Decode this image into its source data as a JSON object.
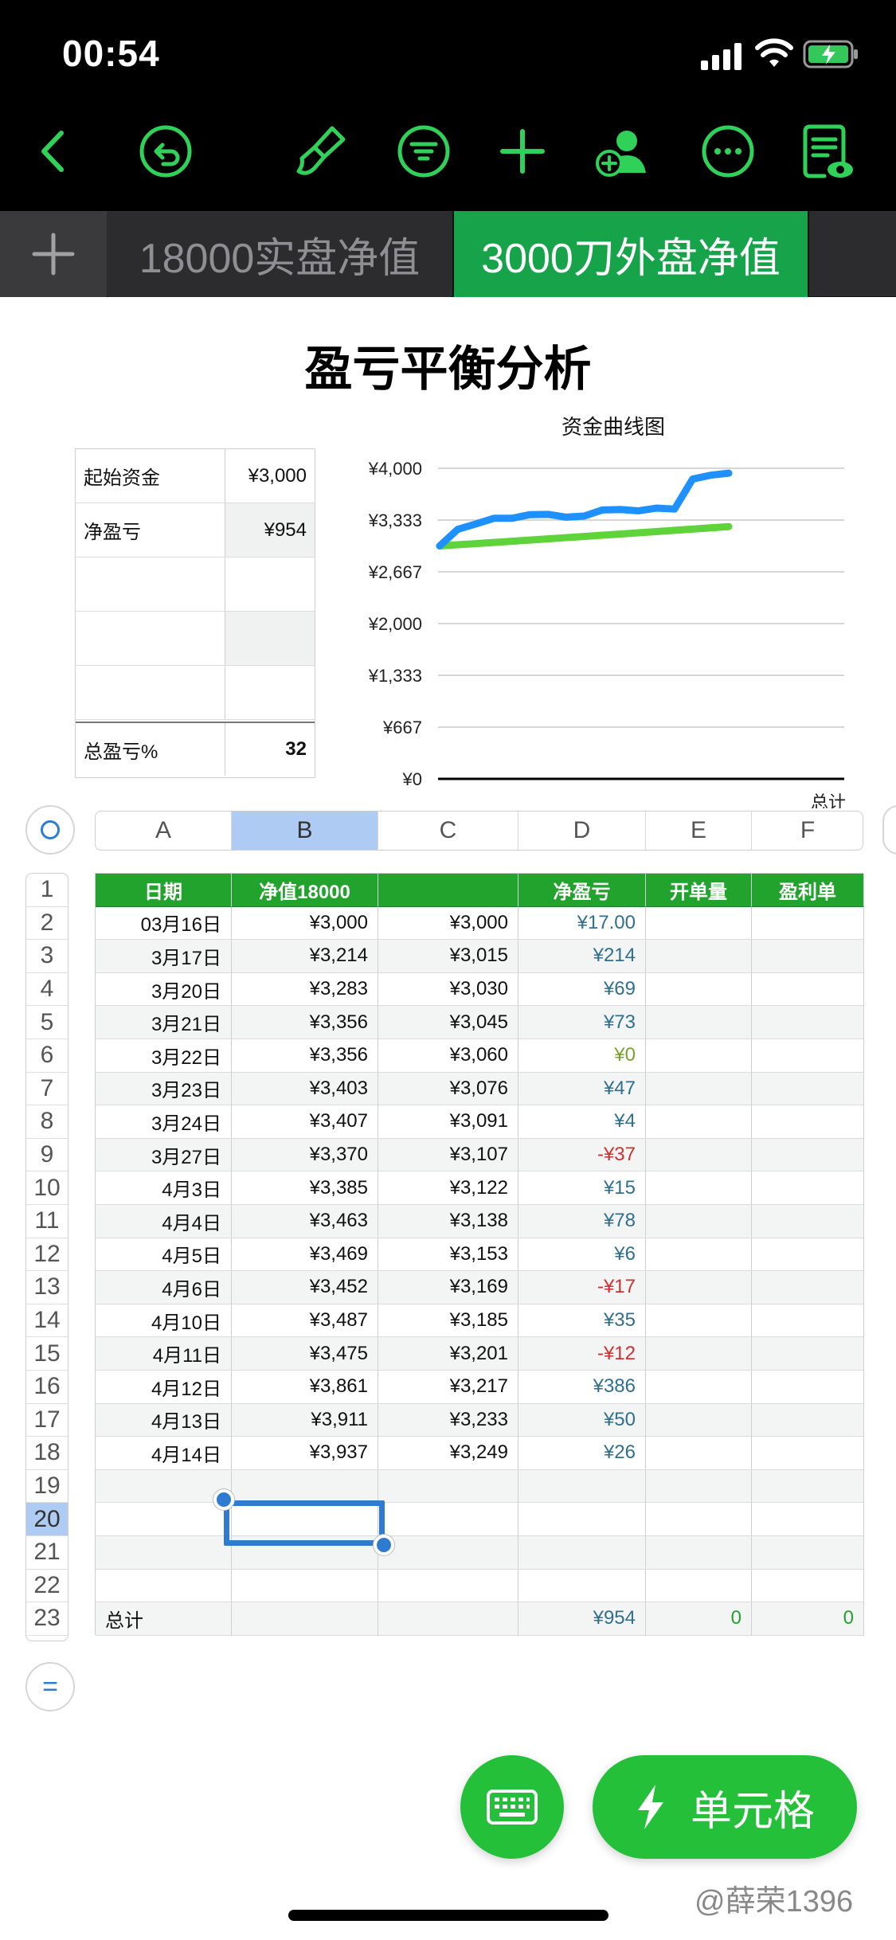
{
  "status_bar": {
    "time": "00:54"
  },
  "toolbar": {
    "icons": [
      "back-icon",
      "undo-icon",
      "brush-icon",
      "filter-icon",
      "add-icon",
      "collaborate-icon",
      "more-icon",
      "reading-view-icon"
    ],
    "accent_color": "#30d158"
  },
  "sheet_tabs": {
    "add_label": "+",
    "tabs": [
      {
        "label": "18000实盘净值",
        "active": false
      },
      {
        "label": "3000刀外盘净值",
        "active": true
      }
    ]
  },
  "page_title": "盈亏平衡分析",
  "summary_table": {
    "rows": [
      {
        "label": "起始资金",
        "value": "¥3,000"
      },
      {
        "label": "净盈亏",
        "value": "¥954"
      },
      {
        "label": "",
        "value": ""
      },
      {
        "label": "",
        "value": ""
      },
      {
        "label": "",
        "value": ""
      },
      {
        "label": "总盈亏%",
        "value": "32"
      }
    ]
  },
  "chart_data": {
    "type": "line",
    "title": "资金曲线图",
    "xlabel": "总计",
    "ylabel": "",
    "ylim": [
      0,
      4000
    ],
    "y_ticks": [
      "¥0",
      "¥667",
      "¥1,333",
      "¥2,000",
      "¥2,667",
      "¥3,333",
      "¥4,000"
    ],
    "grid": true,
    "x": [
      "03月16日",
      "3月17日",
      "3月20日",
      "3月21日",
      "3月22日",
      "3月23日",
      "3月24日",
      "3月27日",
      "4月3日",
      "4月4日",
      "4月5日",
      "4月6日",
      "4月10日",
      "4月11日",
      "4月12日",
      "4月13日",
      "4月14日"
    ],
    "series": [
      {
        "color": "#1e90ff",
        "values": [
          3000,
          3214,
          3283,
          3356,
          3356,
          3403,
          3407,
          3370,
          3385,
          3463,
          3469,
          3452,
          3487,
          3475,
          3861,
          3911,
          3937
        ]
      },
      {
        "color": "#5fd33a",
        "values": [
          3000,
          3015,
          3030,
          3045,
          3060,
          3076,
          3091,
          3107,
          3122,
          3138,
          3153,
          3169,
          3185,
          3201,
          3217,
          3233,
          3249
        ]
      }
    ]
  },
  "column_headers": [
    "A",
    "B",
    "C",
    "D",
    "E",
    "F"
  ],
  "selected_column": "B",
  "row_headers": [
    "1",
    "2",
    "3",
    "4",
    "5",
    "6",
    "7",
    "8",
    "9",
    "10",
    "11",
    "12",
    "13",
    "14",
    "15",
    "16",
    "17",
    "18",
    "19",
    "20",
    "21",
    "22",
    "23"
  ],
  "selected_row": "20",
  "table": {
    "header": [
      "日期",
      "净值18000",
      "",
      "净盈亏",
      "开单量",
      "盈利单"
    ],
    "rows": [
      [
        "03月16日",
        "¥3,000",
        "¥3,000",
        "¥17.00",
        "",
        ""
      ],
      [
        "3月17日",
        "¥3,214",
        "¥3,015",
        "¥214",
        "",
        ""
      ],
      [
        "3月20日",
        "¥3,283",
        "¥3,030",
        "¥69",
        "",
        ""
      ],
      [
        "3月21日",
        "¥3,356",
        "¥3,045",
        "¥73",
        "",
        ""
      ],
      [
        "3月22日",
        "¥3,356",
        "¥3,060",
        "¥0",
        "",
        ""
      ],
      [
        "3月23日",
        "¥3,403",
        "¥3,076",
        "¥47",
        "",
        ""
      ],
      [
        "3月24日",
        "¥3,407",
        "¥3,091",
        "¥4",
        "",
        ""
      ],
      [
        "3月27日",
        "¥3,370",
        "¥3,107",
        "-¥37",
        "",
        ""
      ],
      [
        "4月3日",
        "¥3,385",
        "¥3,122",
        "¥15",
        "",
        ""
      ],
      [
        "4月4日",
        "¥3,463",
        "¥3,138",
        "¥78",
        "",
        ""
      ],
      [
        "4月5日",
        "¥3,469",
        "¥3,153",
        "¥6",
        "",
        ""
      ],
      [
        "4月6日",
        "¥3,452",
        "¥3,169",
        "-¥17",
        "",
        ""
      ],
      [
        "4月10日",
        "¥3,487",
        "¥3,185",
        "¥35",
        "",
        ""
      ],
      [
        "4月11日",
        "¥3,475",
        "¥3,201",
        "-¥12",
        "",
        ""
      ],
      [
        "4月12日",
        "¥3,861",
        "¥3,217",
        "¥386",
        "",
        ""
      ],
      [
        "4月13日",
        "¥3,911",
        "¥3,233",
        "¥50",
        "",
        ""
      ],
      [
        "4月14日",
        "¥3,937",
        "¥3,249",
        "¥26",
        "",
        ""
      ],
      [
        "",
        "",
        "",
        "",
        "",
        ""
      ],
      [
        "",
        "",
        "",
        "",
        "",
        ""
      ],
      [
        "",
        "",
        "",
        "",
        "",
        ""
      ],
      [
        "",
        "",
        "",
        "",
        "",
        ""
      ]
    ],
    "footer": [
      "总计",
      "",
      "",
      "¥954",
      "0",
      "0"
    ]
  },
  "fab": {
    "keyboard_icon": "keyboard-icon",
    "cell_label": "单元格",
    "cell_icon": "bolt-icon"
  },
  "watermark": "@薛荣1396"
}
